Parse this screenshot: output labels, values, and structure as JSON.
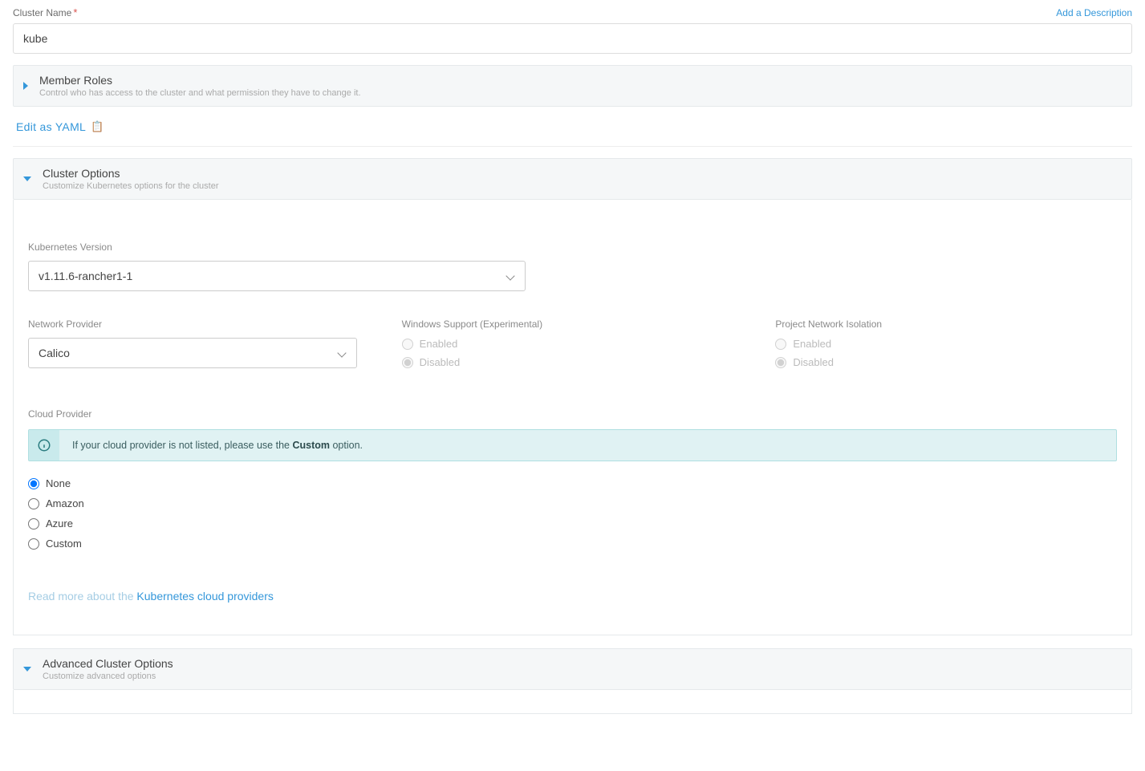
{
  "top": {
    "cluster_name_label": "Cluster Name",
    "add_description": "Add a Description",
    "cluster_name_value": "kube"
  },
  "member_roles": {
    "title": "Member Roles",
    "subtitle": "Control who has access to the cluster and what permission they have to change it."
  },
  "edit_as_yaml": "Edit as YAML",
  "cluster_options": {
    "title": "Cluster Options",
    "subtitle": "Customize Kubernetes options for the cluster"
  },
  "k8s": {
    "label": "Kubernetes Version",
    "value": "v1.11.6-rancher1-1"
  },
  "network": {
    "label": "Network Provider",
    "value": "Calico"
  },
  "windows": {
    "label": "Windows Support (Experimental)",
    "enabled": "Enabled",
    "disabled": "Disabled"
  },
  "pni": {
    "label": "Project Network Isolation",
    "enabled": "Enabled",
    "disabled": "Disabled"
  },
  "cloud": {
    "label": "Cloud Provider",
    "info_prefix": "If your cloud provider is not listed, please use the ",
    "info_bold": "Custom",
    "info_suffix": " option.",
    "none": "None",
    "amazon": "Amazon",
    "azure": "Azure",
    "custom": "Custom"
  },
  "read_more": {
    "prefix": "Read more about the ",
    "link": "Kubernetes cloud providers"
  },
  "advanced": {
    "title": "Advanced Cluster Options",
    "subtitle": "Customize advanced options"
  }
}
